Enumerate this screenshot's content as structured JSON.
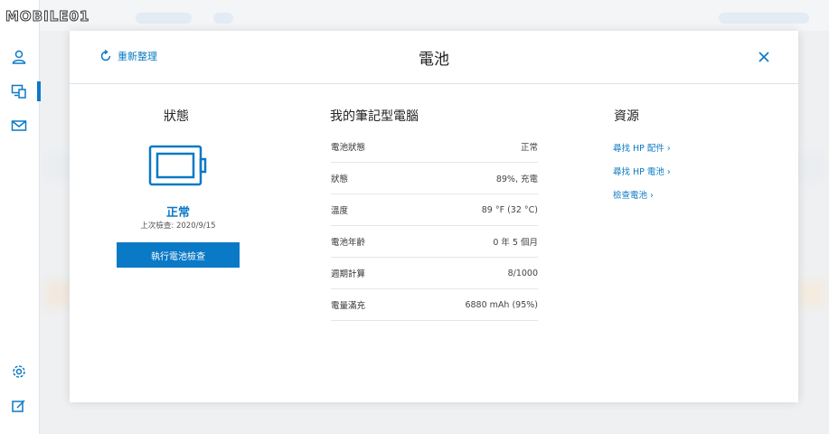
{
  "watermark": "MOBILE01",
  "sidebar": {
    "items": [
      {
        "icon": "user-icon"
      },
      {
        "icon": "devices-icon",
        "active": true
      },
      {
        "icon": "mail-icon"
      },
      {
        "icon": "gear-icon"
      },
      {
        "icon": "feedback-icon"
      }
    ]
  },
  "dialog": {
    "refresh_label": "重新整理",
    "title": "電池"
  },
  "status": {
    "heading": "狀態",
    "value": "正常",
    "last_check": "上次檢查: 2020/9/15",
    "check_button": "執行電池檢查"
  },
  "laptop": {
    "heading": "我的筆記型電腦",
    "rows": [
      {
        "label": "電池狀態",
        "value": "正常"
      },
      {
        "label": "狀態",
        "value": "89%, 充電"
      },
      {
        "label": "溫度",
        "value": "89 °F (32 °C)"
      },
      {
        "label": "電池年齡",
        "value": "0 年 5 個月"
      },
      {
        "label": "週期計算",
        "value": "8/1000"
      },
      {
        "label": "電量滿充",
        "value": "6880 mAh (95%)"
      }
    ]
  },
  "resources": {
    "heading": "資源",
    "links": [
      {
        "label": "尋找 HP 配件 ›"
      },
      {
        "label": "尋找 HP 電池 ›"
      },
      {
        "label": "檢查電池 ›"
      }
    ]
  },
  "colors": {
    "accent": "#0a79c6",
    "background": "#eef0f2"
  }
}
